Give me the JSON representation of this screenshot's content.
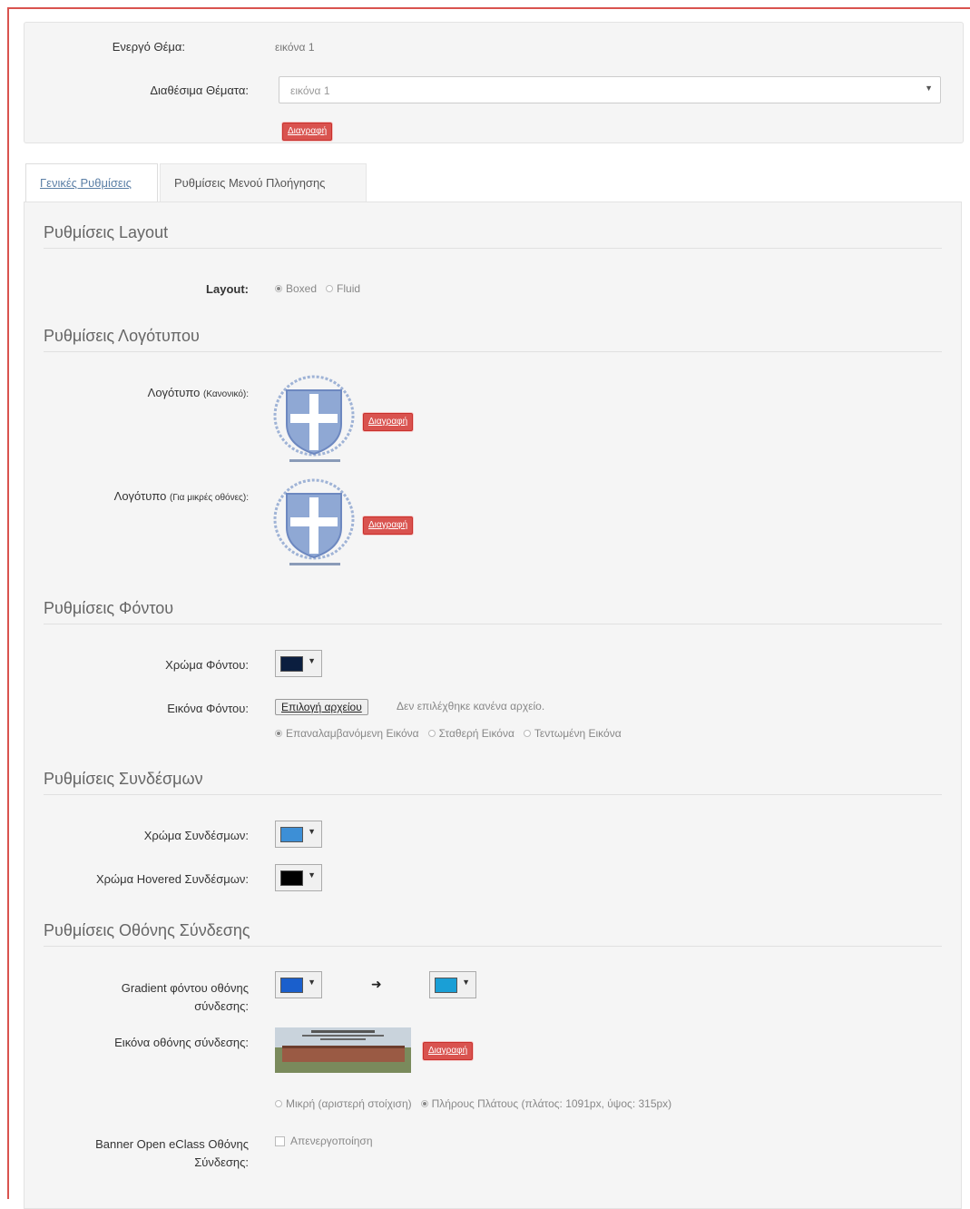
{
  "theme": {
    "active_label": "Ενεργό Θέμα:",
    "active_value": "εικόνα 1",
    "available_label": "Διαθέσιμα Θέματα:",
    "available_selected": "εικόνα 1",
    "delete_label": "Διαγραφή"
  },
  "tabs": [
    {
      "label": "Γενικές Ρυθμίσεις",
      "active": true
    },
    {
      "label": "Ρυθμίσεις Μενού Πλοήγησης",
      "active": false
    }
  ],
  "layout_section": {
    "title": "Ρυθμίσεις Layout",
    "label": "Layout:",
    "options": [
      "Boxed",
      "Fluid"
    ],
    "selected": "Boxed"
  },
  "logo_section": {
    "title": "Ρυθμίσεις Λογότυπου",
    "logo_normal_label": "Λογότυπο",
    "logo_normal_sub": "(Κανονικό):",
    "logo_small_label": "Λογότυπο",
    "logo_small_sub": "(Για μικρές οθόνες):",
    "delete_label": "Διαγραφή",
    "logo_caption": "Τ.Ε.Ι. ΔΥΤΙΚΗΣ ΕΛΛΑΔΑΣ"
  },
  "background_section": {
    "title": "Ρυθμίσεις Φόντου",
    "color_label": "Χρώμα Φόντου:",
    "color_value": "#0b1e3f",
    "image_label": "Εικόνα Φόντου:",
    "file_button": "Επιλογή αρχείου",
    "file_status": "Δεν επιλέχθηκε κανένα αρχείο.",
    "image_options": [
      "Επαναλαμβανόμενη Εικόνα",
      "Σταθερή Εικόνα",
      "Τεντωμένη Εικόνα"
    ],
    "image_selected": "Επαναλαμβανόμενη Εικόνα"
  },
  "links_section": {
    "title": "Ρυθμίσεις Συνδέσμων",
    "color_label": "Χρώμα Συνδέσμων:",
    "color_value": "#3d8fd6",
    "hover_label": "Χρώμα Hovered Συνδέσμων:",
    "hover_value": "#000000"
  },
  "login_section": {
    "title": "Ρυθμίσεις Οθόνης Σύνδεσης",
    "gradient_label_line1": "Gradient φόντου οθόνης",
    "gradient_label_line2": "σύνδεσης:",
    "gradient_from": "#1a5fcc",
    "gradient_to": "#1a9fd6",
    "arrow_glyph": "➜",
    "image_label": "Εικόνα οθόνης σύνδεσης:",
    "delete_label": "Διαγραφή",
    "size_options": [
      "Μικρή (αριστερή στοίχιση)",
      "Πλήρους Πλάτους (πλάτος: 1091px, ύψος: 315px)"
    ],
    "size_selected": "Πλήρους Πλάτους (πλάτος: 1091px, ύψος: 315px)",
    "banner_label_line1": "Banner Open eClass Οθόνης",
    "banner_label_line2": "Σύνδεσης:",
    "banner_checkbox": "Απενεργοποίηση"
  },
  "colors": {
    "danger": "#d9534f",
    "panel_bg": "#f5f5f5",
    "tab_link": "#5b7fa6"
  }
}
